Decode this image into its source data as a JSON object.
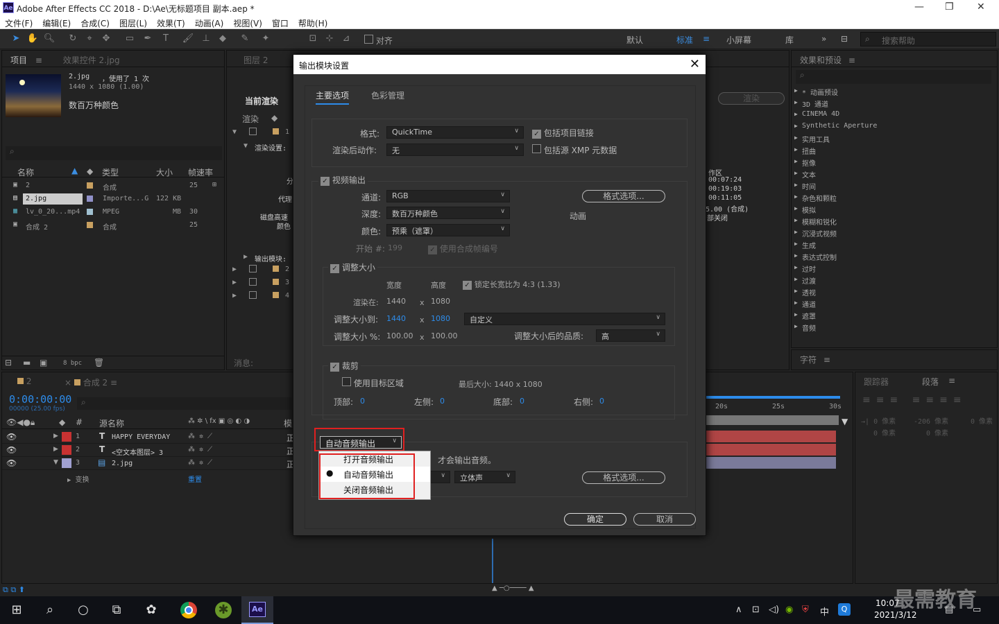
{
  "window": {
    "title": "Adobe After Effects CC 2018 - D:\\Ae\\无标题项目 副本.aep *",
    "app_icon": "Ae"
  },
  "menu": [
    "文件(F)",
    "编辑(E)",
    "合成(C)",
    "图层(L)",
    "效果(T)",
    "动画(A)",
    "视图(V)",
    "窗口",
    "帮助(H)"
  ],
  "toolbar": {
    "snap_label": "对齐",
    "workspaces": [
      "默认",
      "标准",
      "小屏幕",
      "库"
    ],
    "active_workspace": "标准",
    "search_placeholder": "搜索帮助"
  },
  "project_panel": {
    "tab_project": "项目",
    "tab_effects_controls": "效果控件 2.jpg",
    "selected_item_name": "2.jpg",
    "selected_item_usage": "，使用了 1 次",
    "selected_item_dims": "1440 x 1080 (1.00)",
    "selected_item_color": "数百万种颜色",
    "columns": [
      "名称",
      "类型",
      "大小",
      "帧速率"
    ],
    "items": [
      {
        "name": "2",
        "type": "合成",
        "size": "",
        "fps": "25",
        "color": "#c8a060"
      },
      {
        "name": "2.jpg",
        "type": "Importe...G",
        "size": "122 KB",
        "fps": "",
        "color": "#9090c8"
      },
      {
        "name": "lv_0_20...mp4",
        "type": "MPEG",
        "size": "MB",
        "fps": "30",
        "color": "#a0c0d0"
      },
      {
        "name": "合成 2",
        "type": "合成",
        "size": "",
        "fps": "25",
        "color": "#c8a060"
      }
    ],
    "bpc": "8 bpc"
  },
  "render_panel": {
    "tab_layer": "图层 2",
    "current_render": "当前渲染",
    "render_col": "渲染",
    "render_settings": "渲染设置:",
    "output_module": "输出模块:",
    "render_button": "渲染",
    "messages": "消息:",
    "labels_left": [
      "分",
      "代理",
      "磁盘高速",
      "颜色"
    ],
    "info_right": [
      "作区",
      "00:07:24",
      "00:19:03",
      "00:11:05",
      "5.00 (合成)",
      "部关闭"
    ],
    "row_numbers": [
      "1",
      "2",
      "3",
      "4"
    ]
  },
  "effects_panel": {
    "title": "效果和预设",
    "search_placeholder": "",
    "items": [
      "* 动画预设",
      "3D 通道",
      "CINEMA 4D",
      "Synthetic Aperture",
      "实用工具",
      "扭曲",
      "抠像",
      "文本",
      "时间",
      "杂色和颗粒",
      "模拟",
      "模糊和锐化",
      "沉浸式视频",
      "生成",
      "表达式控制",
      "过时",
      "过渡",
      "透视",
      "通道",
      "遮罩",
      "音频"
    ]
  },
  "character_panel": {
    "title": "字符"
  },
  "tracker_panel": {
    "tab_tracker": "跟踪器",
    "tab_paragraph": "段落",
    "px_values": [
      "0 像素",
      "-206 像素",
      "0 像素",
      "0 像素",
      "0 像素"
    ]
  },
  "timeline": {
    "tab_2": "2",
    "tab_comp2": "合成 2",
    "timecode": "0:00:00:00",
    "timecode_sub": "00000 (25.00 fps)",
    "col_source": "源名称",
    "col_mode": "模",
    "layers": [
      {
        "num": "1",
        "name": "HAPPY EVERYDAY",
        "kind": "T",
        "color": "#c83232",
        "mode": "正"
      },
      {
        "num": "2",
        "name": "<空文本图层> 3",
        "kind": "T",
        "color": "#c83232",
        "mode": "正"
      },
      {
        "num": "3",
        "name": "2.jpg",
        "kind": "img",
        "color": "#a0a0d0",
        "mode": "正"
      }
    ],
    "transform_label": "变换",
    "reset_label": "重置",
    "ruler": [
      "20s",
      "25s",
      "30s"
    ]
  },
  "dialog": {
    "title": "输出模块设置",
    "tabs": [
      "主要选项",
      "色彩管理"
    ],
    "active_tab": "主要选项",
    "format_label": "格式:",
    "format_value": "QuickTime",
    "post_render_label": "渲染后动作:",
    "post_render_value": "无",
    "include_project_link": "包括项目链接",
    "include_xmp": "包括源 XMP 元数据",
    "video_output": "视频输出",
    "channel_label": "通道:",
    "channel_value": "RGB",
    "depth_label": "深度:",
    "depth_value": "数百万种颜色",
    "color_label": "颜色:",
    "color_value": "预乘（遮罩）",
    "start_label": "开始 #:",
    "start_value": "199",
    "use_comp_frame": "使用合成帧编号",
    "format_options": "格式选项...",
    "animation_label": "动画",
    "resize": "调整大小",
    "width_label": "宽度",
    "height_label": "高度",
    "lock_aspect": "锁定长宽比为 4:3 (1.33)",
    "render_at_label": "渲染在:",
    "render_at_w": "1440",
    "render_at_h": "1080",
    "resize_to_label": "调整大小到:",
    "resize_to_w": "1440",
    "resize_to_h": "1080",
    "resize_preset": "自定义",
    "resize_pct_label": "调整大小 %:",
    "resize_pct_w": "100.00",
    "resize_pct_h": "100.00",
    "quality_label": "调整大小后的品质:",
    "quality_value": "高",
    "x": "x",
    "crop": "裁剪",
    "use_roi": "使用目标区域",
    "final_size": "最后大小: 1440 x 1080",
    "top_label": "顶部:",
    "left_label": "左侧:",
    "bottom_label": "底部:",
    "right_label": "右侧:",
    "zero": "0",
    "audio_select": "自动音频输出",
    "audio_note": "才会输出音频。",
    "stereo": "立体声",
    "audio_format_options": "格式选项...",
    "ok": "确定",
    "cancel": "取消"
  },
  "audio_popup": {
    "options": [
      "打开音频输出",
      "自动音频输出",
      "关闭音频输出"
    ],
    "selected": "自动音频输出"
  },
  "taskbar": {
    "time": "10:07",
    "date": "2021/3/12",
    "ime": "中",
    "watermark": "最需教育"
  }
}
